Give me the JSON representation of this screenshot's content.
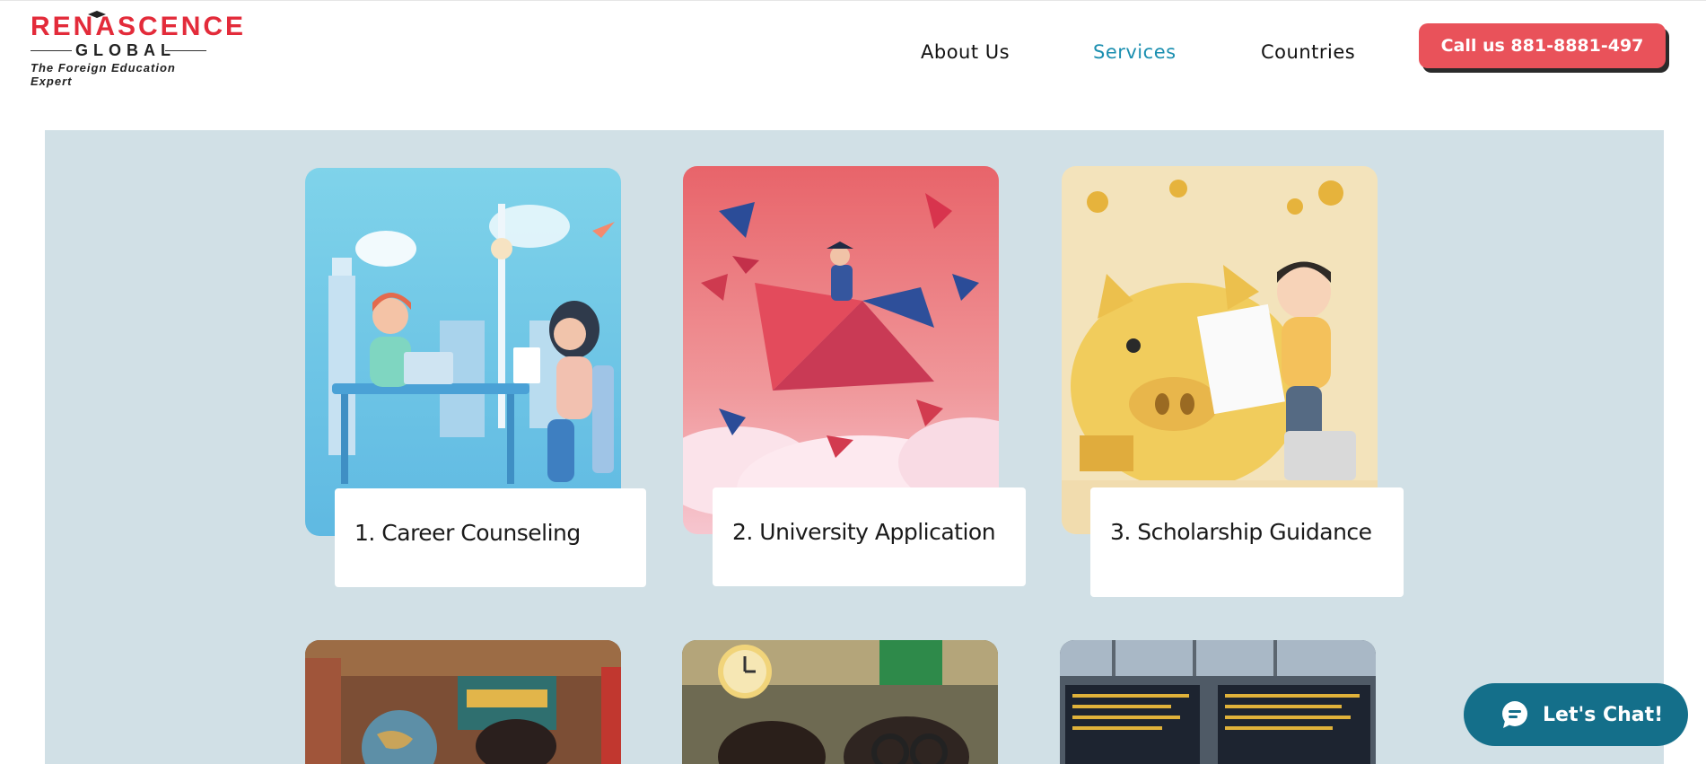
{
  "header": {
    "logo": {
      "line1": "RENASCENCE",
      "line2": "GLOBAL",
      "tagline": "The Foreign Education Expert"
    },
    "nav": [
      {
        "label": "About Us",
        "active": false
      },
      {
        "label": "Services",
        "active": true
      },
      {
        "label": "Countries",
        "active": false
      }
    ],
    "call_button": "Call us 881-8881-497"
  },
  "services": [
    {
      "label": "1. Career Counseling",
      "image": "career-counseling-illustration"
    },
    {
      "label": "2. University Application",
      "image": "university-application-illustration"
    },
    {
      "label": "3. Scholarship Guidance",
      "image": "scholarship-guidance-illustration"
    }
  ],
  "services_row2_images": [
    "globe-student-illustration",
    "students-clock-illustration",
    "airport-departures-illustration"
  ],
  "chat": {
    "label": "Let's Chat!",
    "icon": "chat-bubble-icon"
  },
  "colors": {
    "accent_red": "#e9525a",
    "active_nav": "#1b8fb0",
    "strip_bg": "#d1e0e6",
    "chat_bg": "#146f8a"
  }
}
